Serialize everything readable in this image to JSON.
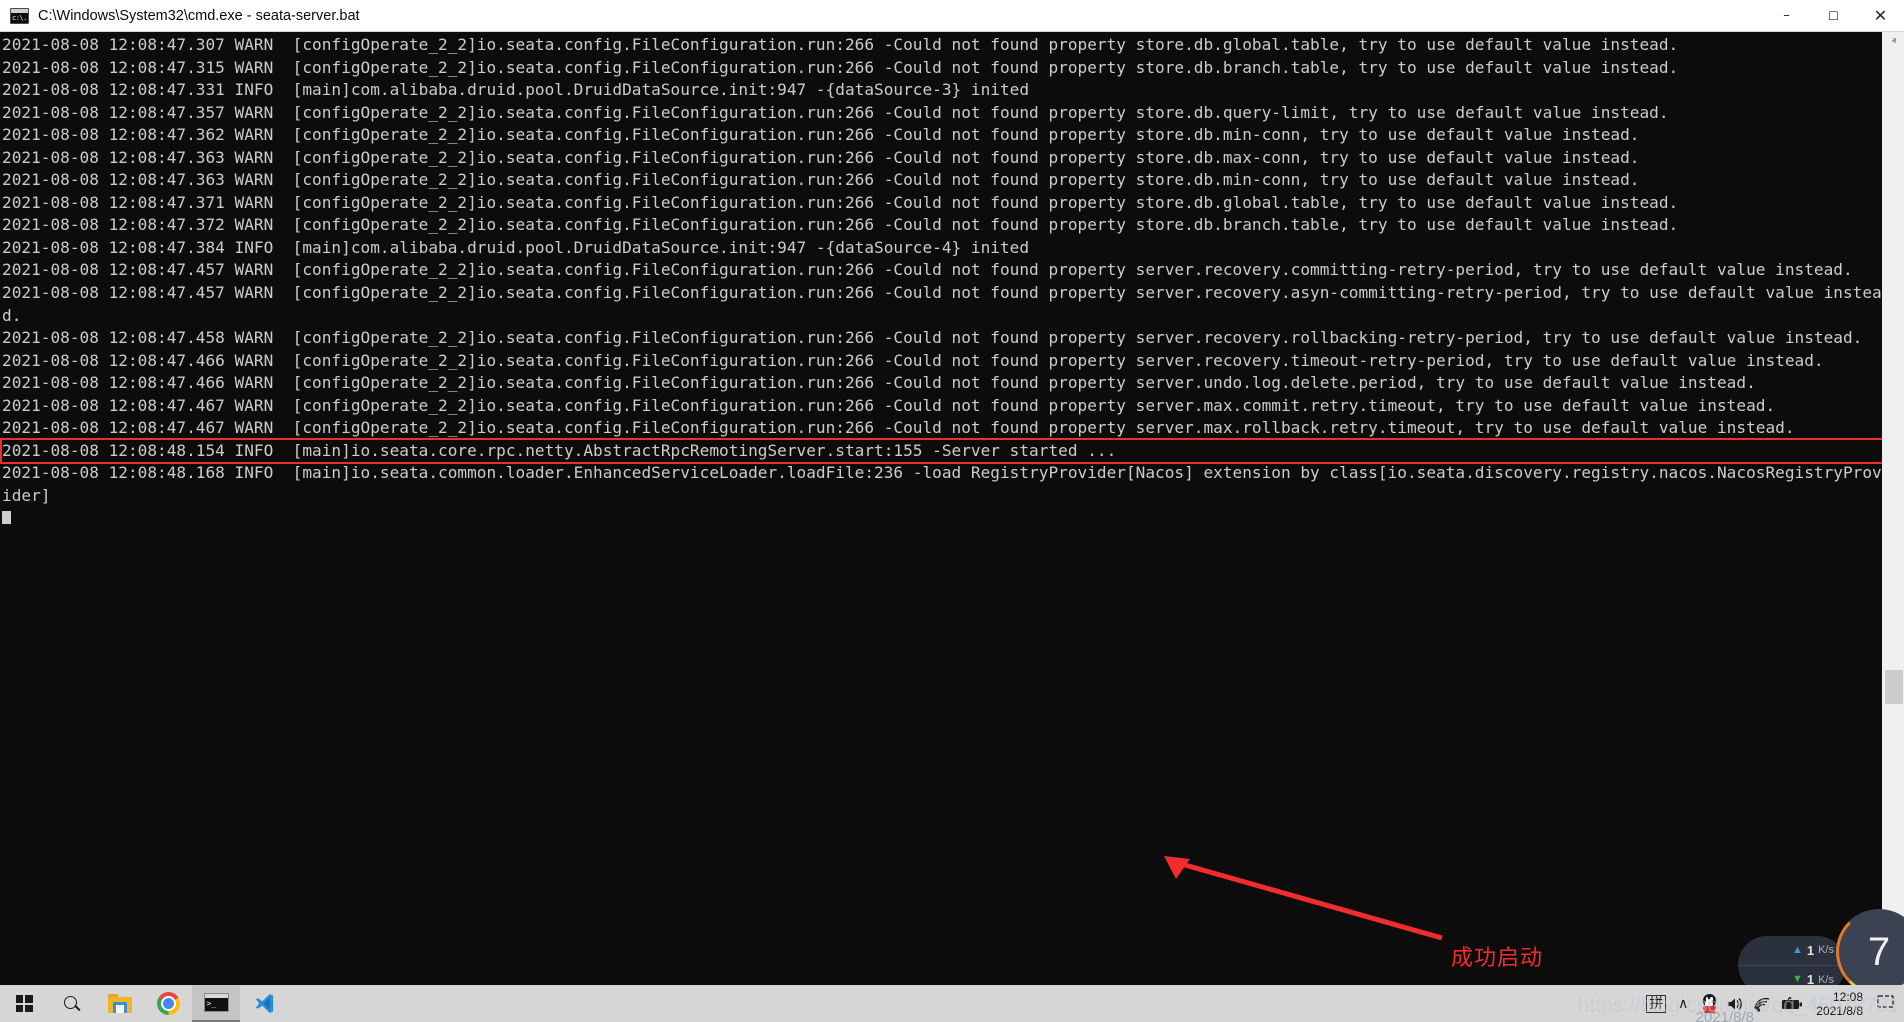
{
  "window": {
    "title": "C:\\Windows\\System32\\cmd.exe - seata-server.bat",
    "icon": "cmd-icon",
    "controls": {
      "minimize": "–",
      "maximize": "☐",
      "close": "✕"
    }
  },
  "console": {
    "lines": [
      {
        "text": "2021-08-08 12:08:47.307 WARN  [configOperate_2_2]io.seata.config.FileConfiguration.run:266 -Could not found property store.db.global.table, try to use default value instead.",
        "highlight": false
      },
      {
        "text": "2021-08-08 12:08:47.315 WARN  [configOperate_2_2]io.seata.config.FileConfiguration.run:266 -Could not found property store.db.branch.table, try to use default value instead.",
        "highlight": false
      },
      {
        "text": "2021-08-08 12:08:47.331 INFO  [main]com.alibaba.druid.pool.DruidDataSource.init:947 -{dataSource-3} inited",
        "highlight": false
      },
      {
        "text": "2021-08-08 12:08:47.357 WARN  [configOperate_2_2]io.seata.config.FileConfiguration.run:266 -Could not found property store.db.query-limit, try to use default value instead.",
        "highlight": false
      },
      {
        "text": "2021-08-08 12:08:47.362 WARN  [configOperate_2_2]io.seata.config.FileConfiguration.run:266 -Could not found property store.db.min-conn, try to use default value instead.",
        "highlight": false
      },
      {
        "text": "2021-08-08 12:08:47.363 WARN  [configOperate_2_2]io.seata.config.FileConfiguration.run:266 -Could not found property store.db.max-conn, try to use default value instead.",
        "highlight": false
      },
      {
        "text": "2021-08-08 12:08:47.363 WARN  [configOperate_2_2]io.seata.config.FileConfiguration.run:266 -Could not found property store.db.min-conn, try to use default value instead.",
        "highlight": false
      },
      {
        "text": "2021-08-08 12:08:47.371 WARN  [configOperate_2_2]io.seata.config.FileConfiguration.run:266 -Could not found property store.db.global.table, try to use default value instead.",
        "highlight": false
      },
      {
        "text": "2021-08-08 12:08:47.372 WARN  [configOperate_2_2]io.seata.config.FileConfiguration.run:266 -Could not found property store.db.branch.table, try to use default value instead.",
        "highlight": false
      },
      {
        "text": "2021-08-08 12:08:47.384 INFO  [main]com.alibaba.druid.pool.DruidDataSource.init:947 -{dataSource-4} inited",
        "highlight": false
      },
      {
        "text": "2021-08-08 12:08:47.457 WARN  [configOperate_2_2]io.seata.config.FileConfiguration.run:266 -Could not found property server.recovery.committing-retry-period, try to use default value instead.",
        "highlight": false
      },
      {
        "text": "2021-08-08 12:08:47.457 WARN  [configOperate_2_2]io.seata.config.FileConfiguration.run:266 -Could not found property server.recovery.asyn-committing-retry-period, try to use default value instead.",
        "highlight": false
      },
      {
        "text": "2021-08-08 12:08:47.458 WARN  [configOperate_2_2]io.seata.config.FileConfiguration.run:266 -Could not found property server.recovery.rollbacking-retry-period, try to use default value instead.",
        "highlight": false
      },
      {
        "text": "2021-08-08 12:08:47.466 WARN  [configOperate_2_2]io.seata.config.FileConfiguration.run:266 -Could not found property server.recovery.timeout-retry-period, try to use default value instead.",
        "highlight": false
      },
      {
        "text": "2021-08-08 12:08:47.466 WARN  [configOperate_2_2]io.seata.config.FileConfiguration.run:266 -Could not found property server.undo.log.delete.period, try to use default value instead.",
        "highlight": false
      },
      {
        "text": "2021-08-08 12:08:47.467 WARN  [configOperate_2_2]io.seata.config.FileConfiguration.run:266 -Could not found property server.max.commit.retry.timeout, try to use default value instead.",
        "highlight": false
      },
      {
        "text": "2021-08-08 12:08:47.467 WARN  [configOperate_2_2]io.seata.config.FileConfiguration.run:266 -Could not found property server.max.rollback.retry.timeout, try to use default value instead.",
        "highlight": false
      },
      {
        "text": "2021-08-08 12:08:48.154 INFO  [main]io.seata.core.rpc.netty.AbstractRpcRemotingServer.start:155 -Server started ...",
        "highlight": true
      },
      {
        "text": "2021-08-08 12:08:48.168 INFO  [main]io.seata.common.loader.EnhancedServiceLoader.loadFile:236 -load RegistryProvider[Nacos] extension by class[io.seata.discovery.registry.nacos.NacosRegistryProvider]",
        "highlight": false
      }
    ],
    "cursor_visible": true,
    "fg_color": "#ccccc8",
    "bg_color": "#0c0c0c",
    "highlight_color": "#f22c2c"
  },
  "annotation": {
    "label": "成功启动",
    "color": "#f22c2c"
  },
  "scrollbar": {
    "up_arrow": "ⱏ",
    "down_arrow": "ⱟ"
  },
  "net_widget": {
    "upload": {
      "arrow": "▲",
      "value": "1",
      "unit": "K/s"
    },
    "download": {
      "arrow": "▼",
      "value": "1",
      "unit": "K/s"
    },
    "gauge_value": "7"
  },
  "taskbar": {
    "items": [
      {
        "name": "start-button",
        "icon": "windows-logo-icon",
        "active": false
      },
      {
        "name": "search-button",
        "icon": "search-icon",
        "active": false
      },
      {
        "name": "file-explorer-button",
        "icon": "folder-icon",
        "active": false
      },
      {
        "name": "chrome-button",
        "icon": "chrome-icon",
        "active": false
      },
      {
        "name": "cmd-button",
        "icon": "cmd-icon",
        "active": true
      },
      {
        "name": "vscode-button",
        "icon": "vscode-icon",
        "active": false
      }
    ],
    "tray": {
      "ime": "拼",
      "overflow": "∧",
      "qq": "qq-icon",
      "volume": "🔊",
      "wifi": "wifi-icon",
      "battery": "battery-icon",
      "clock_time": "12:08",
      "clock_date": "2021/8/8",
      "notifications": "❐"
    }
  },
  "watermark": {
    "url": "https://blog.csdn.net/qq_45078781",
    "extra": "2021/8/8"
  }
}
